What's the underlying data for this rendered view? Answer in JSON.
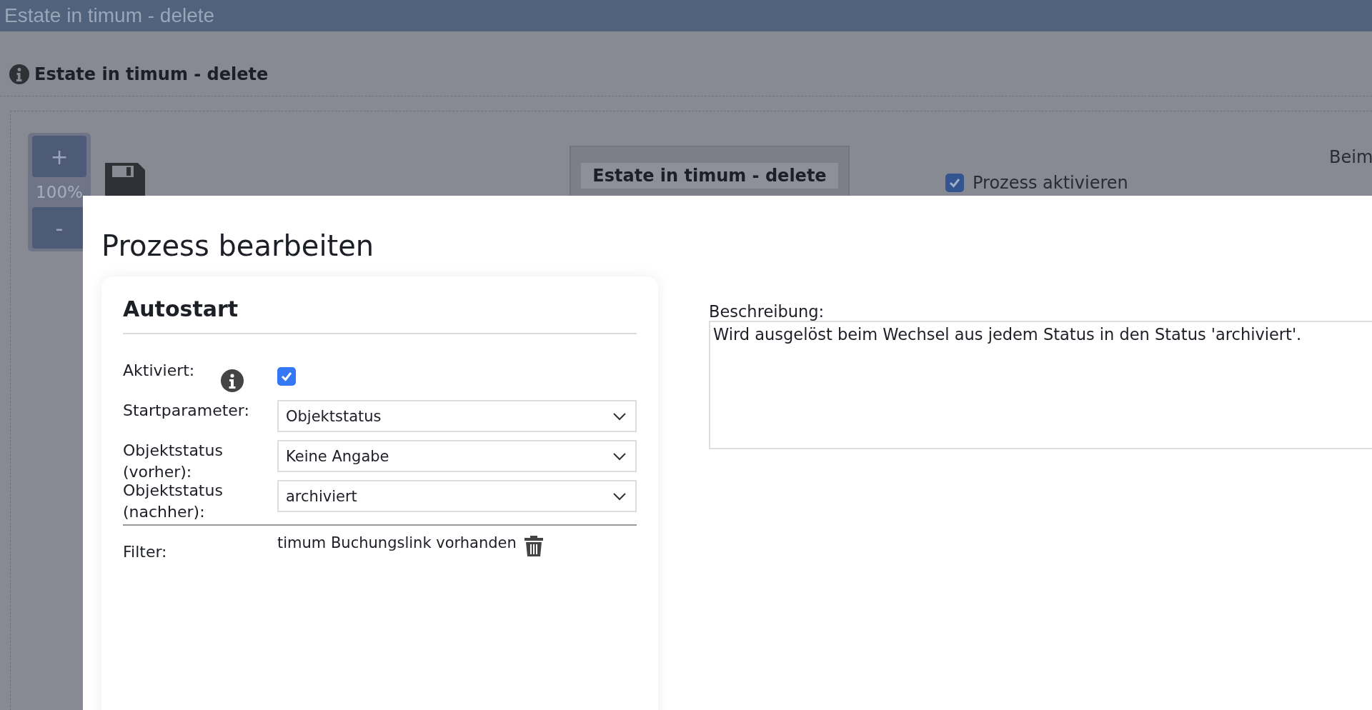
{
  "window": {
    "title": "Estate in timum - delete"
  },
  "page": {
    "heading": "Estate in timum - delete",
    "zoom": {
      "plus": "+",
      "level": "100%",
      "minus": "-"
    },
    "node": {
      "title": "Estate in timum - delete"
    },
    "activate": {
      "label": "Prozess aktivieren",
      "checked": true
    },
    "side_text": "Beim"
  },
  "dialog": {
    "title": "Prozess bearbeiten",
    "autostart": {
      "title": "Autostart",
      "rows": [
        {
          "kind": "checkbox",
          "label": "Aktiviert:",
          "info": true,
          "checked": true
        },
        {
          "kind": "select",
          "label": "Startparameter:",
          "value": "Objektstatus"
        },
        {
          "kind": "select",
          "label": "Objektstatus (vorher):",
          "value": "Keine Angabe"
        },
        {
          "kind": "select",
          "label": "Objektstatus (nachher):",
          "value": "archiviert"
        },
        {
          "kind": "filter",
          "label": "Filter:",
          "value": "timum Buchungslink vorhanden"
        }
      ]
    },
    "description": {
      "label": "Beschreibung:",
      "value": "Wird ausgelöst beim Wechsel aus jedem Status in den Status 'archiviert'."
    }
  }
}
